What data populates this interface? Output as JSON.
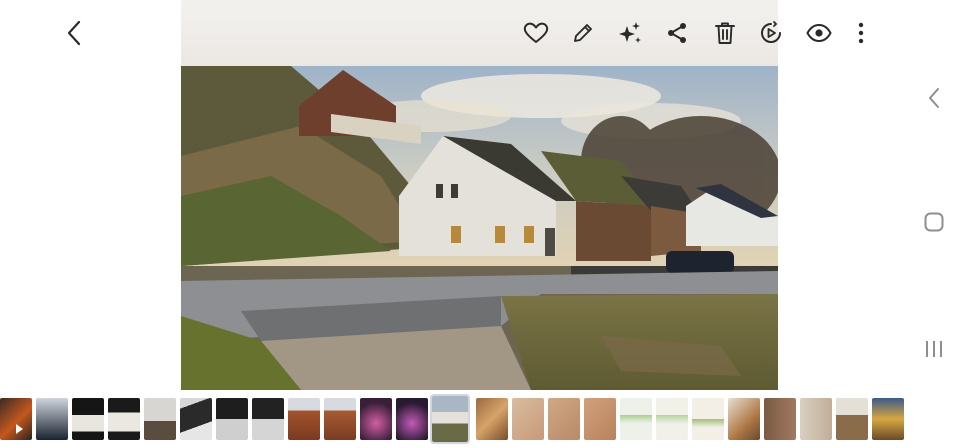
{
  "viewer": {
    "toolbar": {
      "back_icon": "chevron-left-icon",
      "favorite_icon": "heart-icon",
      "edit_icon": "pencil-icon",
      "ai_icon": "sparkle-icon",
      "share_icon": "share-icon",
      "delete_icon": "trash-icon",
      "remaster_icon": "play-circle-icon",
      "view_icon": "eye-icon",
      "more_icon": "more-vertical-icon"
    },
    "photo": {
      "subject": "village-houses-photo"
    },
    "thumbnails": {
      "count": 25,
      "active_index": 12,
      "video_index": 0
    }
  },
  "system_nav": {
    "back_icon": "nav-back-icon",
    "home_icon": "nav-home-icon",
    "recents_icon": "nav-recents-icon"
  },
  "colors": {
    "icon": "#2a2a2a",
    "nav_icon": "#8e8e8e",
    "active_outline": "#cfd6df"
  }
}
